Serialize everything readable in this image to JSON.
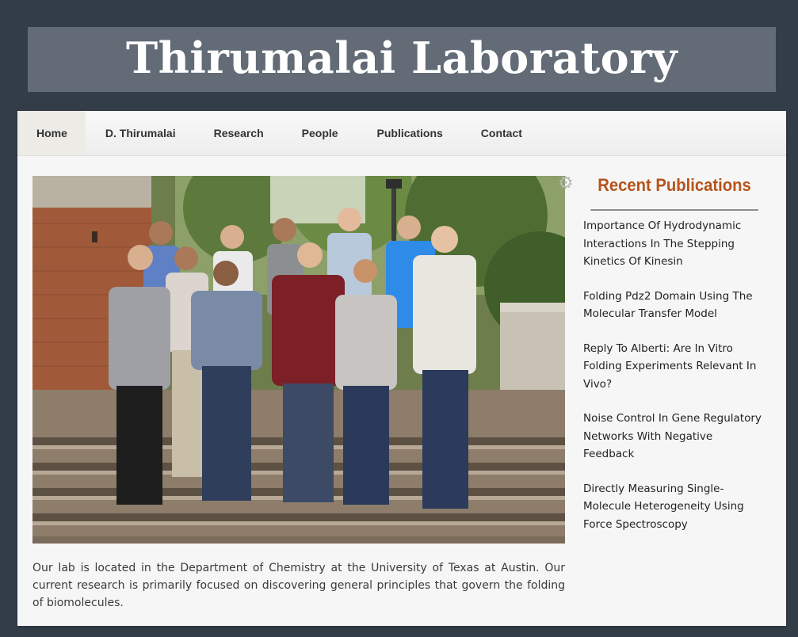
{
  "site": {
    "title": "Thirumalai Laboratory"
  },
  "nav": {
    "items": [
      {
        "label": "Home",
        "active": true
      },
      {
        "label": "D. Thirumalai",
        "active": false
      },
      {
        "label": "Research",
        "active": false
      },
      {
        "label": "People",
        "active": false
      },
      {
        "label": "Publications",
        "active": false
      },
      {
        "label": "Contact",
        "active": false
      }
    ]
  },
  "main": {
    "photo_icon": "group-photo",
    "intro": "Our lab is located in the Department of Chemistry at the University of Texas at Austin. Our current research is primarily focused on discovering general principles that govern the folding of biomolecules."
  },
  "sidebar": {
    "icon": "gear-icon",
    "title": "Recent Publications",
    "publications": [
      "Importance Of Hydrodynamic Interactions In The Stepping Kinetics Of Kinesin",
      "Folding Pdz2 Domain Using The Molecular Transfer Model",
      "Reply To Alberti: Are In Vitro Folding Experiments Relevant In Vivo?",
      "Noise Control In Gene Regulatory Networks With Negative Feedback",
      "Directly Measuring Single-Molecule Heterogeneity Using Force Spectroscopy"
    ]
  },
  "colors": {
    "page_background": "#333d47",
    "banner_background": "#626b76",
    "accent": "#b5541b",
    "panel_background": "#f6f6f6"
  }
}
